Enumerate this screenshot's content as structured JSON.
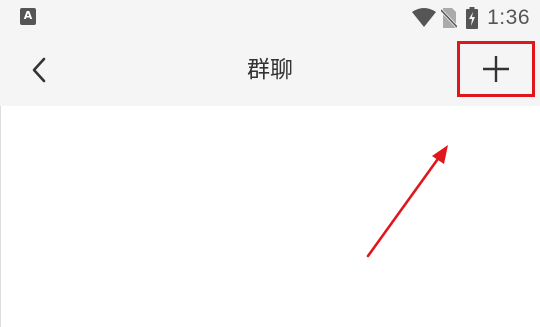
{
  "status_bar": {
    "app_icon_letter": "A",
    "time": "1:36",
    "icons": [
      "app-notification-icon",
      "wifi-icon",
      "no-sim-icon",
      "battery-charging-icon"
    ]
  },
  "toolbar": {
    "title": "群聊",
    "back_icon": "chevron-left-icon",
    "add_icon": "plus-icon"
  },
  "colors": {
    "status_bar_bg": "#f5f5f5",
    "toolbar_bg": "#f5f5f5",
    "content_bg": "#ffffff",
    "icon_color": "#555555",
    "title_color": "#333333",
    "annotation_red": "#e0161c"
  },
  "annotation": {
    "type": "red-highlight-box-and-arrow",
    "target": "add-button"
  }
}
